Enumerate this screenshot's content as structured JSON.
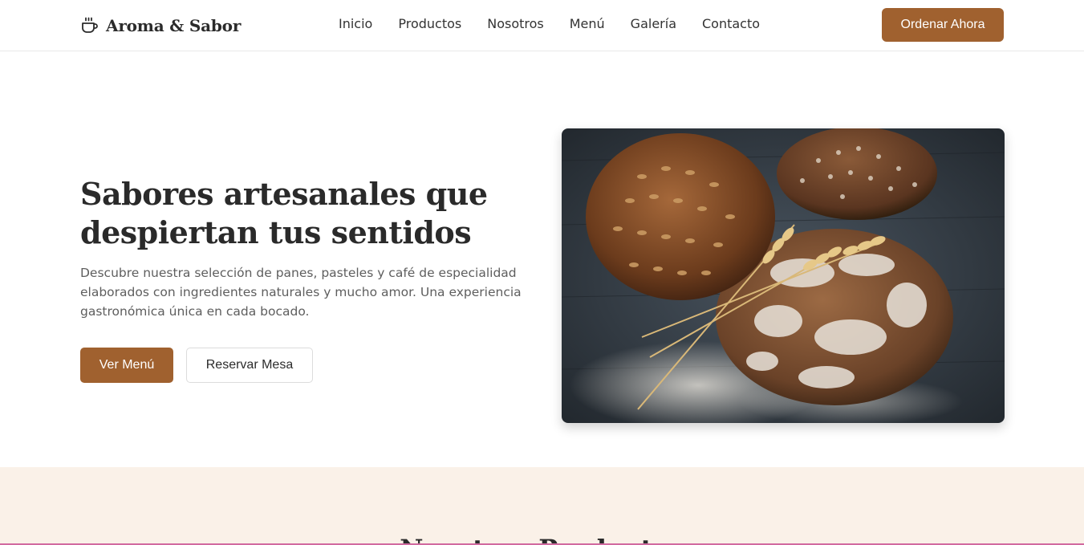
{
  "brand": {
    "name": "Aroma & Sabor",
    "icon": "coffee-cup-icon"
  },
  "nav": {
    "items": [
      {
        "label": "Inicio"
      },
      {
        "label": "Productos"
      },
      {
        "label": "Nosotros"
      },
      {
        "label": "Menú"
      },
      {
        "label": "Galería"
      },
      {
        "label": "Contacto"
      }
    ],
    "cta_label": "Ordenar Ahora"
  },
  "hero": {
    "title": "Sabores artesanales que despiertan tus sentidos",
    "description": "Descubre nuestra selección de panes, pasteles y café de especialidad elaborados con ingredientes naturales y mucho amor. Una experiencia gastronómica única en cada bocado.",
    "primary_button": "Ver Menú",
    "secondary_button": "Reservar Mesa",
    "image": "artisan-bread-photo"
  },
  "products": {
    "title": "Nuestros Productos"
  },
  "colors": {
    "accent": "#a0612f",
    "section_bg": "#faf1e8",
    "text_dark": "#2a2a2a",
    "text_muted": "#5e5e5e"
  }
}
